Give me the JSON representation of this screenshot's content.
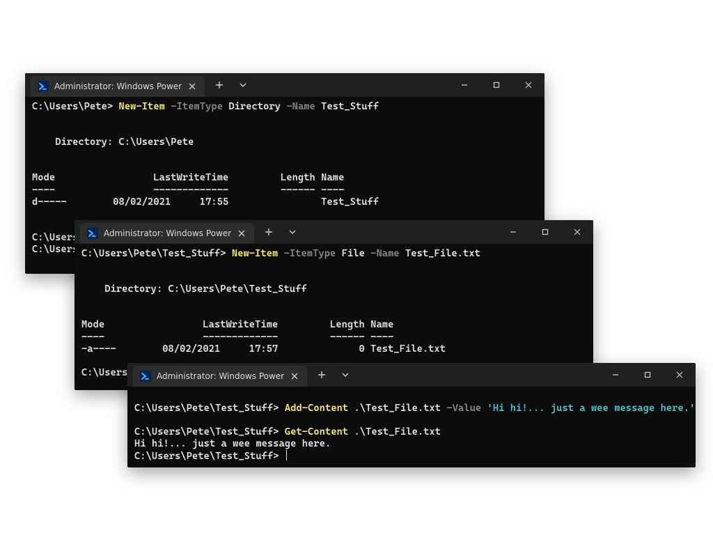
{
  "window1": {
    "tab_title": "Administrator: Windows PowerS",
    "lines": {
      "l0_prompt": "C:\\Users\\Pete> ",
      "l0_cmd": "New-Item",
      "l0_p1": " -ItemType",
      "l0_a1": " Directory",
      "l0_p2": " -Name",
      "l0_a2": " Test_Stuff",
      "blank": "",
      "l1": "    Directory: C:\\Users\\Pete",
      "l2": "Mode                 LastWriteTime         Length Name",
      "l3": "----                 -------------         ------ ----",
      "l4": "d-----        08/02/2021     17:55                Test_Stuff",
      "l5": "C:\\Users",
      "l6": "C:\\Users"
    }
  },
  "window2": {
    "tab_title": "Administrator: Windows PowerS",
    "lines": {
      "l0_prompt": "C:\\Users\\Pete\\Test_Stuff> ",
      "l0_cmd": "New-Item",
      "l0_p1": " -ItemType",
      "l0_a1": " File",
      "l0_p2": " -Name",
      "l0_a2": " Test_File.txt",
      "l1": "    Directory: C:\\Users\\Pete\\Test_Stuff",
      "l2": "Mode                 LastWriteTime         Length Name",
      "l3": "----                 -------------         ------ ----",
      "l4": "-a----        08/02/2021     17:57              0 Test_File.txt",
      "l5": "C:\\Users"
    }
  },
  "window3": {
    "tab_title": "Administrator: Windows PowerS",
    "lines": {
      "l0_prompt": "C:\\Users\\Pete\\Test_Stuff> ",
      "l0_cmd": "Add-Content",
      "l0_a1": " .\\Test_File.txt",
      "l0_p1": " -Value",
      "l0_s1": " 'Hi hi!... just a wee message here.'",
      "l1_prompt": "C:\\Users\\Pete\\Test_Stuff> ",
      "l1_cmd": "Get-Content",
      "l1_a1": " .\\Test_File.txt",
      "l2": "Hi hi!... just a wee message here.",
      "l3": "C:\\Users\\Pete\\Test_Stuff> "
    }
  }
}
